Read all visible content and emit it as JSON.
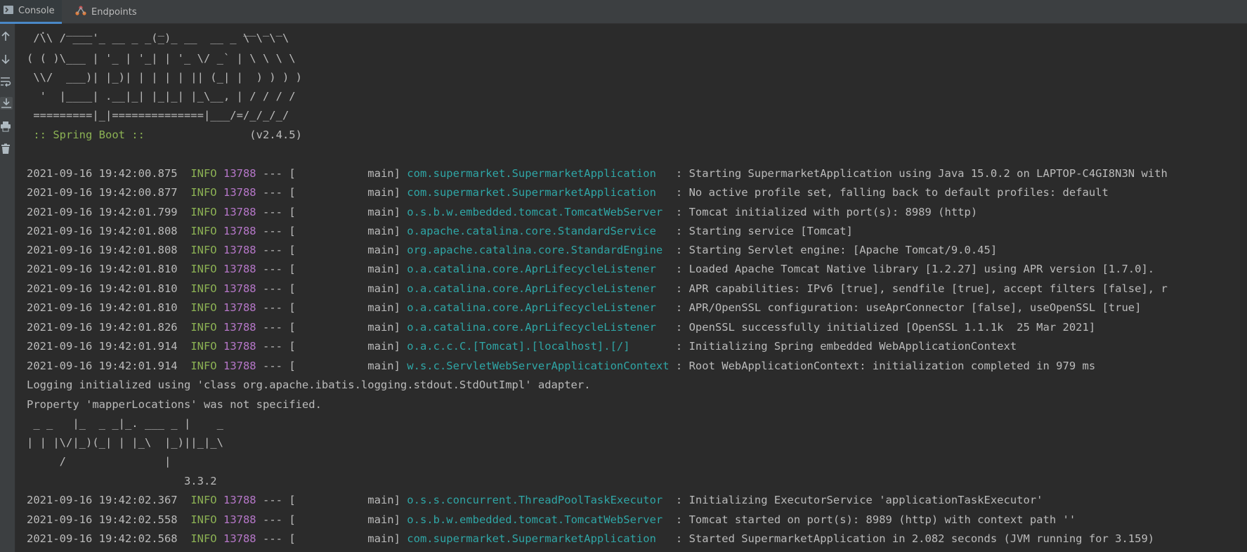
{
  "tabs": [
    {
      "label": "Console",
      "icon": "terminal-icon",
      "active": true
    },
    {
      "label": "Endpoints",
      "icon": "endpoints-icon",
      "active": false
    }
  ],
  "toolbar": {
    "tools": [
      {
        "name": "scroll-up-icon"
      },
      {
        "name": "scroll-down-icon"
      },
      {
        "name": "soft-wrap-icon"
      },
      {
        "name": "scroll-to-end-icon"
      },
      {
        "name": "print-icon"
      },
      {
        "name": "clear-all-icon"
      }
    ]
  },
  "banner": {
    "lines": [
      "  .   ____          _            __ _ _",
      " /\\\\ / ___'_ __ _ _(_)_ __  __ _ \\ \\ \\ \\",
      "( ( )\\___ | '_ | '_| | '_ \\/ _` | \\ \\ \\ \\",
      " \\\\/  ___)| |_)| | | | | || (_| |  ) ) ) )",
      "  '  |____| .__|_| |_|_| |_\\__, | / / / /",
      " =========|_|==============|___/=/_/_/_/"
    ],
    "spring_boot_label": " :: Spring Boot :: ",
    "version": "               (v2.4.5)"
  },
  "log": [
    {
      "ts": "2021-09-16 19:42:00.875",
      "level": "INFO",
      "pid": "13788",
      "sep": " --- [           main] ",
      "logger": "com.supermarket.SupermarketApplication  ",
      "msg": " : Starting SupermarketApplication using Java 15.0.2 on LAPTOP-C4GI8N3N with"
    },
    {
      "ts": "2021-09-16 19:42:00.877",
      "level": "INFO",
      "pid": "13788",
      "sep": " --- [           main] ",
      "logger": "com.supermarket.SupermarketApplication  ",
      "msg": " : No active profile set, falling back to default profiles: default"
    },
    {
      "ts": "2021-09-16 19:42:01.799",
      "level": "INFO",
      "pid": "13788",
      "sep": " --- [           main] ",
      "logger": "o.s.b.w.embedded.tomcat.TomcatWebServer ",
      "msg": " : Tomcat initialized with port(s): 8989 (http)"
    },
    {
      "ts": "2021-09-16 19:42:01.808",
      "level": "INFO",
      "pid": "13788",
      "sep": " --- [           main] ",
      "logger": "o.apache.catalina.core.StandardService  ",
      "msg": " : Starting service [Tomcat]"
    },
    {
      "ts": "2021-09-16 19:42:01.808",
      "level": "INFO",
      "pid": "13788",
      "sep": " --- [           main] ",
      "logger": "org.apache.catalina.core.StandardEngine ",
      "msg": " : Starting Servlet engine: [Apache Tomcat/9.0.45]"
    },
    {
      "ts": "2021-09-16 19:42:01.810",
      "level": "INFO",
      "pid": "13788",
      "sep": " --- [           main] ",
      "logger": "o.a.catalina.core.AprLifecycleListener  ",
      "msg": " : Loaded Apache Tomcat Native library [1.2.27] using APR version [1.7.0]."
    },
    {
      "ts": "2021-09-16 19:42:01.810",
      "level": "INFO",
      "pid": "13788",
      "sep": " --- [           main] ",
      "logger": "o.a.catalina.core.AprLifecycleListener  ",
      "msg": " : APR capabilities: IPv6 [true], sendfile [true], accept filters [false], r"
    },
    {
      "ts": "2021-09-16 19:42:01.810",
      "level": "INFO",
      "pid": "13788",
      "sep": " --- [           main] ",
      "logger": "o.a.catalina.core.AprLifecycleListener  ",
      "msg": " : APR/OpenSSL configuration: useAprConnector [false], useOpenSSL [true]"
    },
    {
      "ts": "2021-09-16 19:42:01.826",
      "level": "INFO",
      "pid": "13788",
      "sep": " --- [           main] ",
      "logger": "o.a.catalina.core.AprLifecycleListener  ",
      "msg": " : OpenSSL successfully initialized [OpenSSL 1.1.1k  25 Mar 2021]"
    },
    {
      "ts": "2021-09-16 19:42:01.914",
      "level": "INFO",
      "pid": "13788",
      "sep": " --- [           main] ",
      "logger": "o.a.c.c.C.[Tomcat].[localhost].[/]      ",
      "msg": " : Initializing Spring embedded WebApplicationContext"
    },
    {
      "ts": "2021-09-16 19:42:01.914",
      "level": "INFO",
      "pid": "13788",
      "sep": " --- [           main] ",
      "logger": "w.s.c.ServletWebServerApplicationContext",
      "msg": " : Root WebApplicationContext: initialization completed in 979 ms"
    }
  ],
  "plain_lines": [
    "Logging initialized using 'class org.apache.ibatis.logging.stdout.StdOutImpl' adapter.",
    "Property 'mapperLocations' was not specified."
  ],
  "mybatis_banner": [
    " _ _   |_  _ _|_. ___ _ |    _ ",
    "| | |\\/|_)(_| | |_\\  |_)||_|_\\ ",
    "     /               |         ",
    "                        3.3.2 "
  ],
  "log2": [
    {
      "ts": "2021-09-16 19:42:02.367",
      "level": "INFO",
      "pid": "13788",
      "sep": " --- [           main] ",
      "logger": "o.s.s.concurrent.ThreadPoolTaskExecutor ",
      "msg": " : Initializing ExecutorService 'applicationTaskExecutor'"
    },
    {
      "ts": "2021-09-16 19:42:02.558",
      "level": "INFO",
      "pid": "13788",
      "sep": " --- [           main] ",
      "logger": "o.s.b.w.embedded.tomcat.TomcatWebServer ",
      "msg": " : Tomcat started on port(s): 8989 (http) with context path ''"
    },
    {
      "ts": "2021-09-16 19:42:02.568",
      "level": "INFO",
      "pid": "13788",
      "sep": " --- [           main] ",
      "logger": "com.supermarket.SupermarketApplication  ",
      "msg": " : Started SupermarketApplication in 2.082 seconds (JVM running for 3.159)"
    }
  ],
  "colors": {
    "background": "#2b2b2b",
    "level_info": "#8cb254",
    "pid": "#b677c9",
    "logger": "#2fa6a6",
    "text": "#bbbbbb"
  }
}
